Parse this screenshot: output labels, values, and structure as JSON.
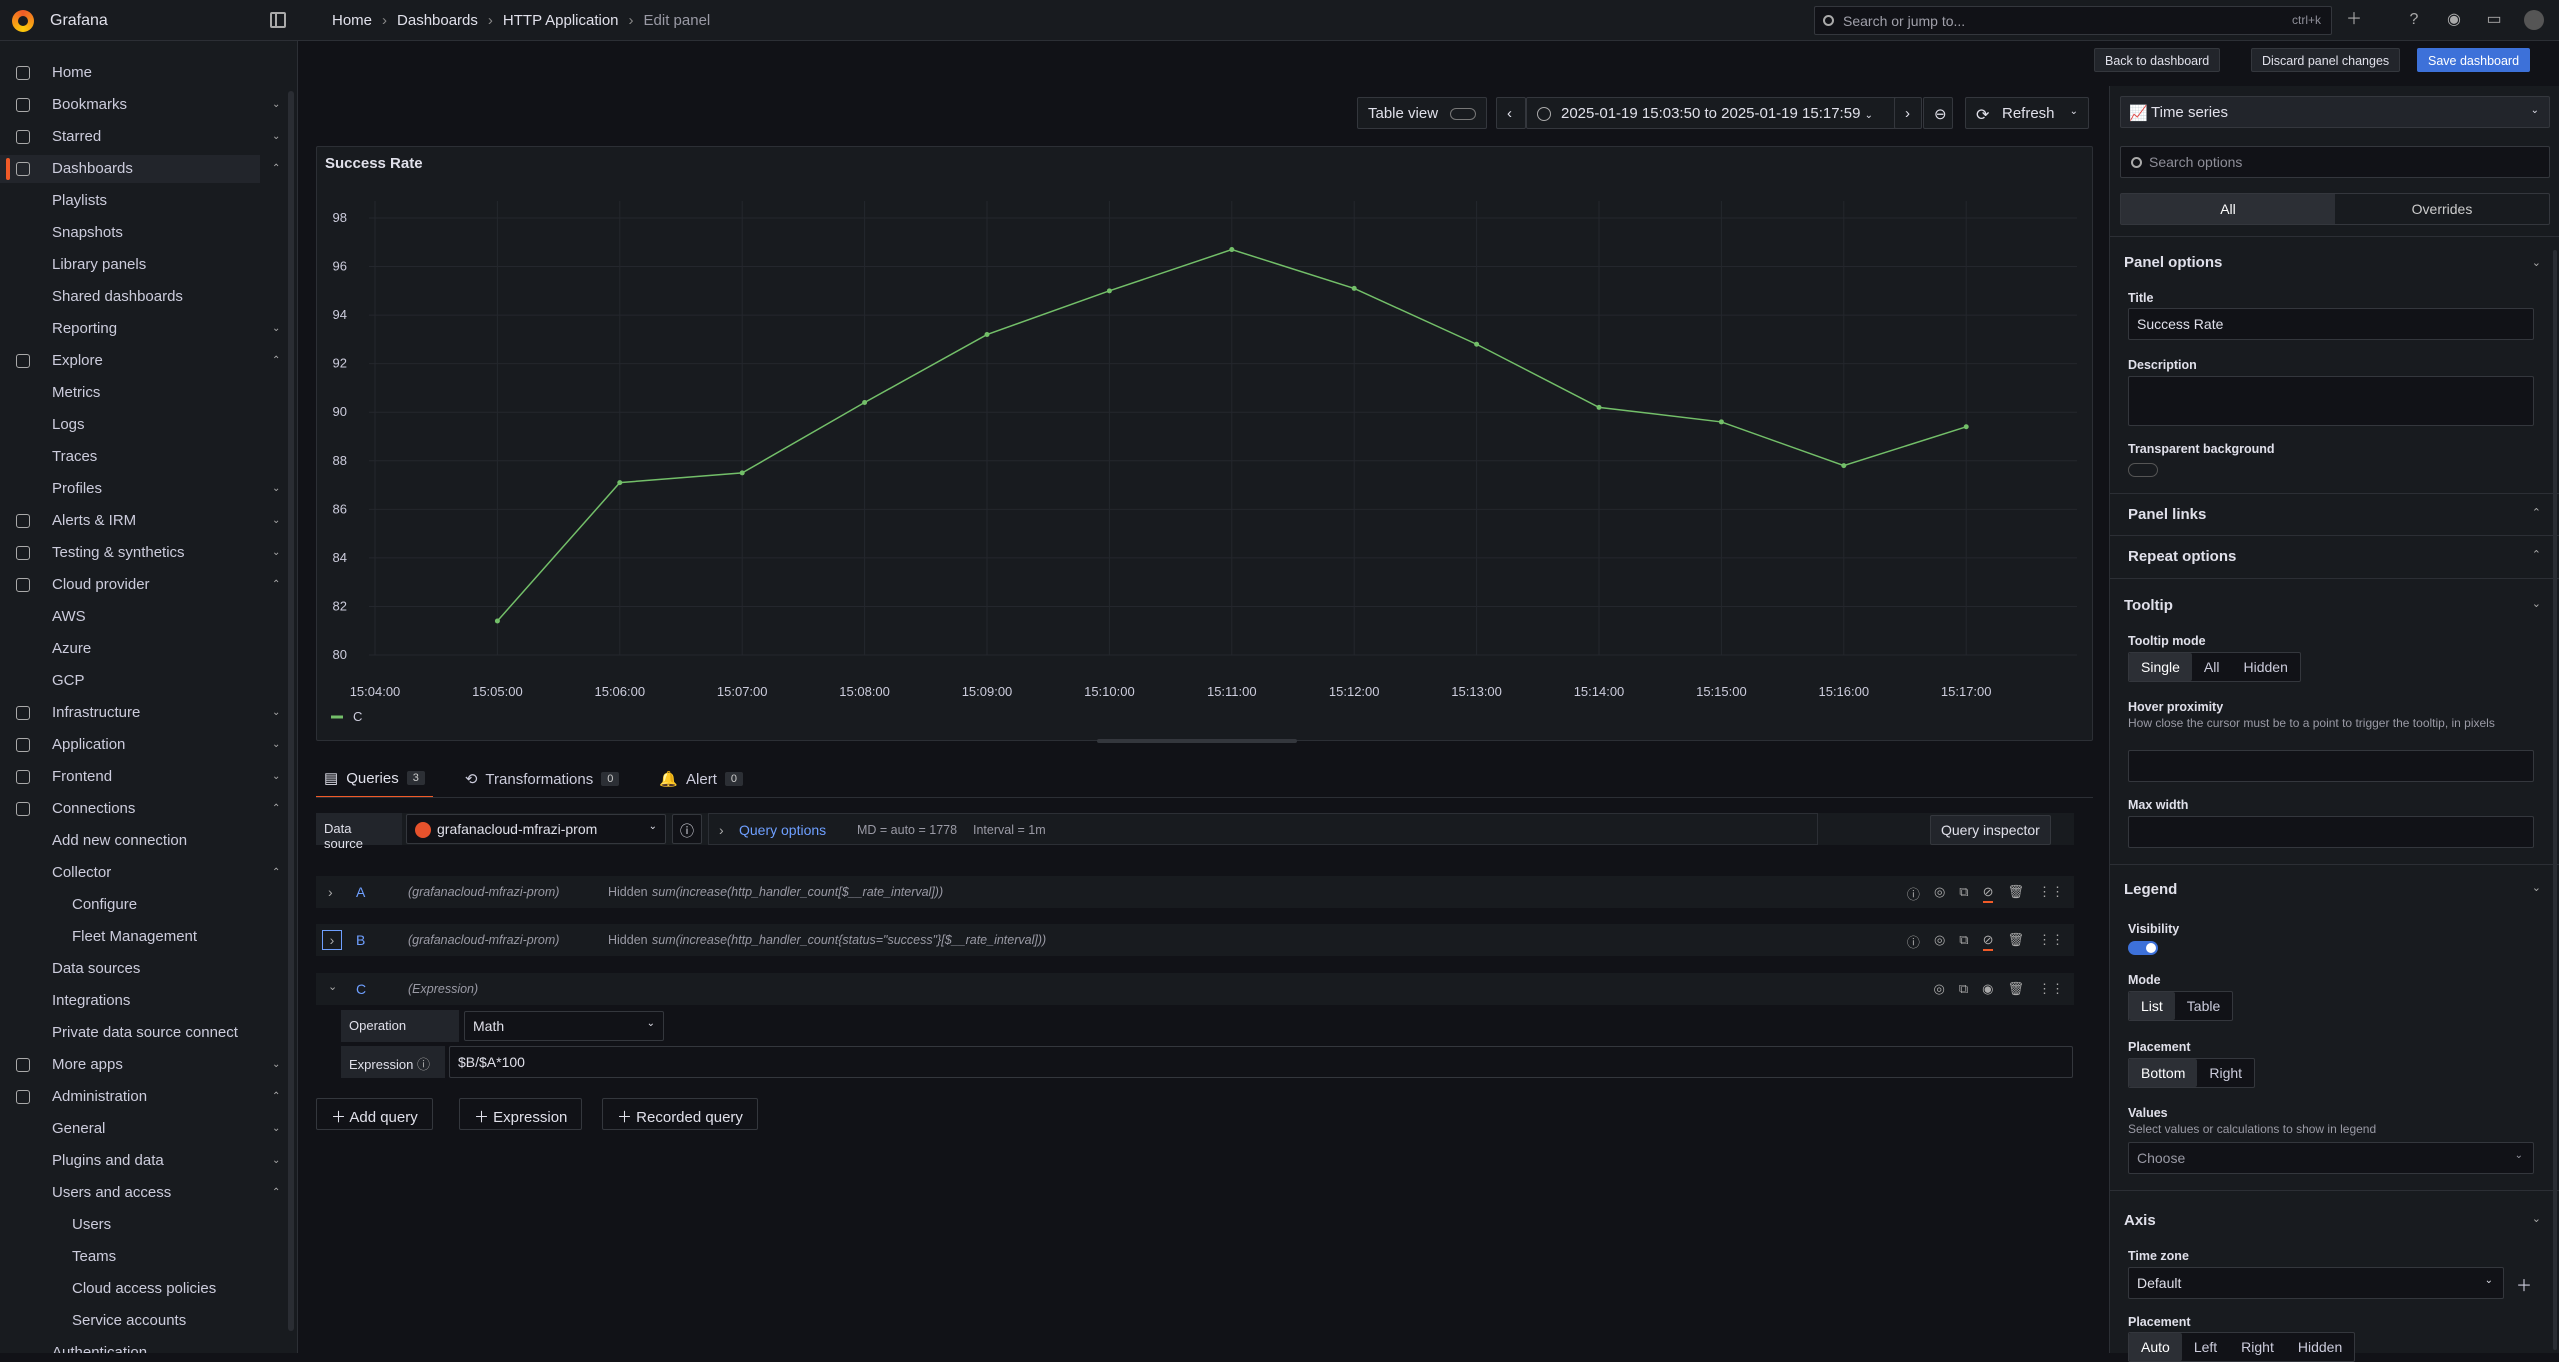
{
  "app": {
    "brand": "Grafana"
  },
  "breadcrumbs": [
    "Home",
    "Dashboards",
    "HTTP Application",
    "Edit panel"
  ],
  "search": {
    "placeholder": "Search or jump to...",
    "shortcut": "ctrl+k"
  },
  "actions": {
    "back": "Back to dashboard",
    "discard": "Discard panel changes",
    "save": "Save dashboard"
  },
  "sidebar": {
    "items": [
      {
        "label": "Home",
        "level": 0
      },
      {
        "label": "Bookmarks",
        "level": 0,
        "chev": "down"
      },
      {
        "label": "Starred",
        "level": 0,
        "chev": "down"
      },
      {
        "label": "Dashboards",
        "level": 0,
        "chev": "up",
        "active": true
      },
      {
        "label": "Playlists",
        "level": 1
      },
      {
        "label": "Snapshots",
        "level": 1
      },
      {
        "label": "Library panels",
        "level": 1
      },
      {
        "label": "Shared dashboards",
        "level": 1
      },
      {
        "label": "Reporting",
        "level": 1,
        "chev": "down"
      },
      {
        "label": "Explore",
        "level": 0,
        "chev": "up"
      },
      {
        "label": "Metrics",
        "level": 1
      },
      {
        "label": "Logs",
        "level": 1
      },
      {
        "label": "Traces",
        "level": 1
      },
      {
        "label": "Profiles",
        "level": 1,
        "chev": "down"
      },
      {
        "label": "Alerts & IRM",
        "level": 0,
        "chev": "down"
      },
      {
        "label": "Testing & synthetics",
        "level": 0,
        "chev": "down"
      },
      {
        "label": "Cloud provider",
        "level": 0,
        "chev": "up"
      },
      {
        "label": "AWS",
        "level": 1
      },
      {
        "label": "Azure",
        "level": 1
      },
      {
        "label": "GCP",
        "level": 1
      },
      {
        "label": "Infrastructure",
        "level": 0,
        "chev": "down"
      },
      {
        "label": "Application",
        "level": 0,
        "chev": "down"
      },
      {
        "label": "Frontend",
        "level": 0,
        "chev": "down"
      },
      {
        "label": "Connections",
        "level": 0,
        "chev": "up"
      },
      {
        "label": "Add new connection",
        "level": 1
      },
      {
        "label": "Collector",
        "level": 1,
        "chev": "up"
      },
      {
        "label": "Configure",
        "level": 2
      },
      {
        "label": "Fleet Management",
        "level": 2
      },
      {
        "label": "Data sources",
        "level": 1
      },
      {
        "label": "Integrations",
        "level": 1
      },
      {
        "label": "Private data source connect",
        "level": 1
      },
      {
        "label": "More apps",
        "level": 0,
        "chev": "down"
      },
      {
        "label": "Administration",
        "level": 0,
        "chev": "up"
      },
      {
        "label": "General",
        "level": 1,
        "chev": "down"
      },
      {
        "label": "Plugins and data",
        "level": 1,
        "chev": "down"
      },
      {
        "label": "Users and access",
        "level": 1,
        "chev": "up"
      },
      {
        "label": "Users",
        "level": 2
      },
      {
        "label": "Teams",
        "level": 2
      },
      {
        "label": "Cloud access policies",
        "level": 2
      },
      {
        "label": "Service accounts",
        "level": 2
      },
      {
        "label": "Authentication",
        "level": 1
      }
    ]
  },
  "toolbar": {
    "table_view": "Table view",
    "time_range": "2025-01-19 15:03:50 to 2025-01-19 15:17:59",
    "refresh": "Refresh"
  },
  "panel": {
    "title": "Success Rate"
  },
  "chart_data": {
    "type": "line",
    "x": [
      "15:05:00",
      "15:06:00",
      "15:07:00",
      "15:08:00",
      "15:09:00",
      "15:10:00",
      "15:11:00",
      "15:12:00",
      "15:13:00",
      "15:14:00",
      "15:15:00",
      "15:16:00",
      "15:17:00"
    ],
    "x_ticks": [
      "15:04:00",
      "15:05:00",
      "15:06:00",
      "15:07:00",
      "15:08:00",
      "15:09:00",
      "15:10:00",
      "15:11:00",
      "15:12:00",
      "15:13:00",
      "15:14:00",
      "15:15:00",
      "15:16:00",
      "15:17:00"
    ],
    "series": [
      {
        "name": "C",
        "color": "#73bf69",
        "values": [
          81.4,
          87.1,
          87.5,
          90.4,
          93.2,
          95.0,
          96.7,
          95.1,
          92.8,
          90.2,
          89.6,
          87.8,
          89.4
        ]
      }
    ],
    "y_ticks": [
      "80",
      "82",
      "84",
      "86",
      "88",
      "90",
      "92",
      "94",
      "96",
      "98"
    ],
    "ylim": [
      80,
      98
    ],
    "grid": true,
    "legend": "bottom-left"
  },
  "query_tabs": [
    {
      "label": "Queries",
      "count": "3"
    },
    {
      "label": "Transformations",
      "count": "0"
    },
    {
      "label": "Alert",
      "count": "0"
    }
  ],
  "datasource": {
    "label": "Data source",
    "value": "grafanacloud-mfrazi-prom",
    "query_options": "Query options",
    "md": "MD = auto = 1778",
    "interval": "Interval = 1m",
    "inspector": "Query inspector"
  },
  "queries": [
    {
      "letter": "A",
      "source": "(grafanacloud-mfrazi-prom)",
      "state": "Hidden",
      "expr": "sum(increase(http_handler_count[$__rate_interval]))"
    },
    {
      "letter": "B",
      "source": "(grafanacloud-mfrazi-prom)",
      "state": "Hidden",
      "expr": "sum(increase(http_handler_count{status=\"success\"}[$__rate_interval]))"
    },
    {
      "letter": "C",
      "source": "(Expression)"
    }
  ],
  "expression": {
    "operation_label": "Operation",
    "operation_value": "Math",
    "expression_label": "Expression",
    "expression_value": "$B/$A*100"
  },
  "add_buttons": {
    "query": "Add query",
    "expression": "Expression",
    "recorded": "Recorded query"
  },
  "options": {
    "viz": "Time series",
    "search_placeholder": "Search options",
    "tab_all": "All",
    "tab_overrides": "Overrides",
    "panel_options": "Panel options",
    "title_label": "Title",
    "title_value": "Success Rate",
    "description_label": "Description",
    "transparent_label": "Transparent background",
    "panel_links": "Panel links",
    "repeat_options": "Repeat options",
    "tooltip": "Tooltip",
    "tooltip_mode": "Tooltip mode",
    "tooltip_modes": [
      "Single",
      "All",
      "Hidden"
    ],
    "hover_label": "Hover proximity",
    "hover_desc": "How close the cursor must be to a point to trigger the tooltip, in pixels",
    "max_width": "Max width",
    "legend": "Legend",
    "visibility": "Visibility",
    "mode": "Mode",
    "modes": [
      "List",
      "Table"
    ],
    "placement": "Placement",
    "placements": [
      "Bottom",
      "Right"
    ],
    "values": "Values",
    "values_desc": "Select values or calculations to show in legend",
    "values_placeholder": "Choose",
    "axis": "Axis",
    "time_zone": "Time zone",
    "time_zone_value": "Default",
    "axis_placement": "Placement",
    "axis_placements": [
      "Auto",
      "Left",
      "Right",
      "Hidden"
    ]
  }
}
